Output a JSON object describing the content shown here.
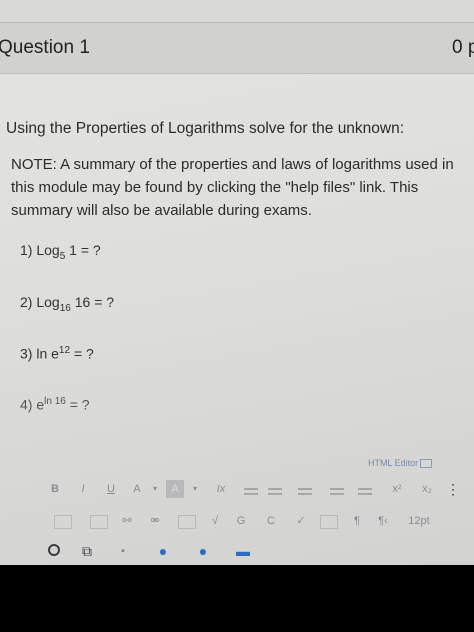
{
  "question": {
    "title": "Question 1",
    "points": "0 p"
  },
  "instructions": "Using the Properties of Logarithms solve for the unknown:",
  "note": "NOTE: A summary of the properties and laws of logarithms used in this module may be found by clicking the \"help files\" link. This summary will also be available during exams.",
  "problems": [
    {
      "num": "1)",
      "func": "Log",
      "sub": "5",
      "arg": "1",
      "rest": "= ?"
    },
    {
      "num": "2)",
      "func": "Log",
      "sub": "16",
      "arg": "16",
      "rest": "= ?"
    },
    {
      "num": "3)",
      "func": "ln e",
      "sup": "12",
      "rest": "= ?"
    },
    {
      "num": "4)",
      "func": "e",
      "sup": "ln 16",
      "rest": "= ?"
    }
  ],
  "editor": {
    "label": "HTML Editor",
    "toolbar1": [
      "B",
      "I",
      "U",
      "A",
      "▾",
      "A",
      "▾",
      "Ix",
      "x²",
      "x₂",
      "⋮"
    ],
    "font_size": "12pt",
    "toolbar2_extra": [
      "¶",
      "¶‹",
      "C"
    ]
  }
}
